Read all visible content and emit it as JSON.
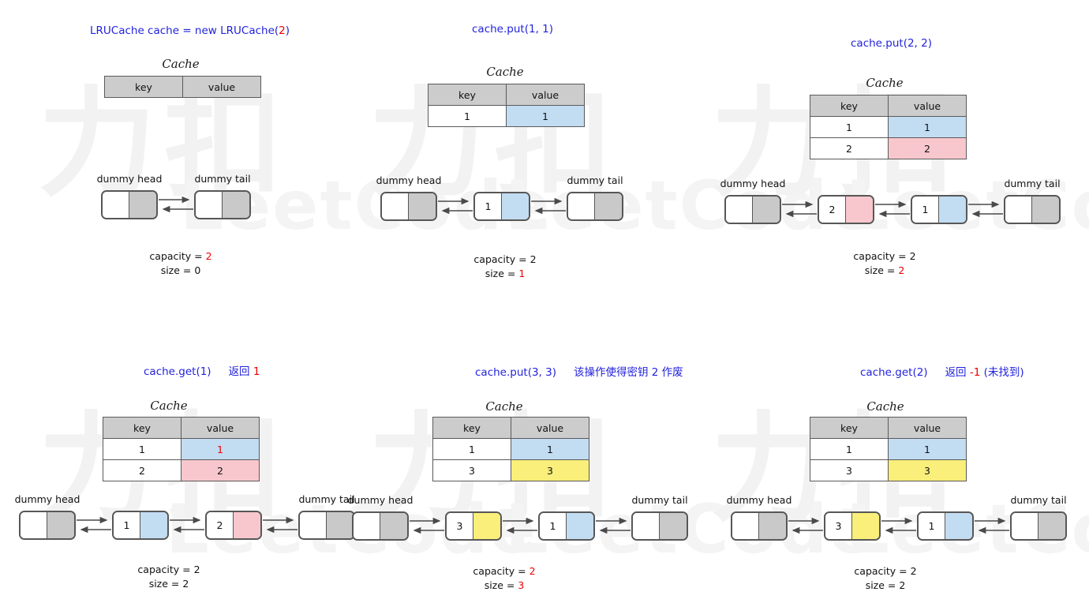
{
  "colors": {
    "op_text": "#2222dd",
    "highlight_red": "#ee0000",
    "value_blue": "#c2dcf2",
    "value_pink": "#f8c7cd",
    "value_yellow": "#f9ef7a",
    "node_gray": "#c9c9c9",
    "header_gray": "#cccccc",
    "border": "#575757"
  },
  "watermark": {
    "cjk": "力扣",
    "word": "LeetCode"
  },
  "labels": {
    "cache_title": "Cache",
    "col_key": "key",
    "col_value": "value",
    "dummy_head": "dummy head",
    "dummy_tail": "dummy tail",
    "capacity_prefix": "capacity = ",
    "size_prefix": "size = "
  },
  "panels": [
    {
      "id": "panel-1-construct",
      "title": {
        "prefix": "LRUCache cache = new LRUCache(",
        "red": "2",
        "suffix": ")",
        "note": "",
        "note_red": "",
        "note_suffix": ""
      },
      "table": {
        "headers": [
          "key",
          "value"
        ],
        "rows": []
      },
      "list": {
        "nodes": [
          {
            "type": "dummy",
            "label": "dummy head",
            "key": "",
            "color": "gray"
          },
          {
            "type": "dummy",
            "label": "dummy tail",
            "key": "",
            "color": "gray"
          }
        ]
      },
      "stats": {
        "capacity": "2",
        "capacity_red": true,
        "size": "0",
        "size_red": false
      }
    },
    {
      "id": "panel-2-put-1-1",
      "title": {
        "prefix": "cache.put(1, 1)",
        "red": "",
        "suffix": "",
        "note": "",
        "note_red": "",
        "note_suffix": ""
      },
      "table": {
        "headers": [
          "key",
          "value"
        ],
        "rows": [
          {
            "key": "1",
            "value": "1",
            "value_color": "blue",
            "value_red": false
          }
        ]
      },
      "list": {
        "nodes": [
          {
            "type": "dummy",
            "label": "dummy head",
            "key": "",
            "color": "gray"
          },
          {
            "type": "data",
            "label": "",
            "key": "1",
            "color": "blue"
          },
          {
            "type": "dummy",
            "label": "dummy tail",
            "key": "",
            "color": "gray"
          }
        ]
      },
      "stats": {
        "capacity": "2",
        "capacity_red": false,
        "size": "1",
        "size_red": true
      }
    },
    {
      "id": "panel-3-put-2-2",
      "title": {
        "prefix": "cache.put(2, 2)",
        "red": "",
        "suffix": "",
        "note": "",
        "note_red": "",
        "note_suffix": ""
      },
      "table": {
        "headers": [
          "key",
          "value"
        ],
        "rows": [
          {
            "key": "1",
            "value": "1",
            "value_color": "blue",
            "value_red": false
          },
          {
            "key": "2",
            "value": "2",
            "value_color": "pink",
            "value_red": false
          }
        ]
      },
      "list": {
        "nodes": [
          {
            "type": "dummy",
            "label": "dummy head",
            "key": "",
            "color": "gray"
          },
          {
            "type": "data",
            "label": "",
            "key": "2",
            "color": "pink"
          },
          {
            "type": "data",
            "label": "",
            "key": "1",
            "color": "blue"
          },
          {
            "type": "dummy",
            "label": "dummy tail",
            "key": "",
            "color": "gray"
          }
        ]
      },
      "stats": {
        "capacity": "2",
        "capacity_red": false,
        "size": "2",
        "size_red": true
      }
    },
    {
      "id": "panel-4-get-1",
      "title": {
        "prefix": "cache.get(1)",
        "red": "",
        "suffix": "",
        "note": "返回 ",
        "note_red": "1",
        "note_suffix": ""
      },
      "table": {
        "headers": [
          "key",
          "value"
        ],
        "rows": [
          {
            "key": "1",
            "value": "1",
            "value_color": "blue",
            "value_red": true
          },
          {
            "key": "2",
            "value": "2",
            "value_color": "pink",
            "value_red": false
          }
        ]
      },
      "list": {
        "nodes": [
          {
            "type": "dummy",
            "label": "dummy head",
            "key": "",
            "color": "gray"
          },
          {
            "type": "data",
            "label": "",
            "key": "1",
            "color": "blue"
          },
          {
            "type": "data",
            "label": "",
            "key": "2",
            "color": "pink"
          },
          {
            "type": "dummy",
            "label": "dummy tail",
            "key": "",
            "color": "gray"
          }
        ]
      },
      "stats": {
        "capacity": "2",
        "capacity_red": false,
        "size": "2",
        "size_red": false
      }
    },
    {
      "id": "panel-5-put-3-3",
      "title": {
        "prefix": "cache.put(3, 3)",
        "red": "",
        "suffix": "",
        "note": "该操作使得密钥 2 作废",
        "note_red": "",
        "note_suffix": ""
      },
      "table": {
        "headers": [
          "key",
          "value"
        ],
        "rows": [
          {
            "key": "1",
            "value": "1",
            "value_color": "blue",
            "value_red": false
          },
          {
            "key": "3",
            "value": "3",
            "value_color": "yellow",
            "value_red": false
          }
        ]
      },
      "list": {
        "nodes": [
          {
            "type": "dummy",
            "label": "dummy head",
            "key": "",
            "color": "gray"
          },
          {
            "type": "data",
            "label": "",
            "key": "3",
            "color": "yellow"
          },
          {
            "type": "data",
            "label": "",
            "key": "1",
            "color": "blue"
          },
          {
            "type": "dummy",
            "label": "dummy tail",
            "key": "",
            "color": "gray"
          }
        ]
      },
      "stats": {
        "capacity": "2",
        "capacity_red": true,
        "size": "3",
        "size_red": true
      }
    },
    {
      "id": "panel-6-get-2",
      "title": {
        "prefix": "cache.get(2)",
        "red": "",
        "suffix": "",
        "note": "返回 ",
        "note_red": "-1",
        "note_suffix": " (未找到)"
      },
      "table": {
        "headers": [
          "key",
          "value"
        ],
        "rows": [
          {
            "key": "1",
            "value": "1",
            "value_color": "blue",
            "value_red": false
          },
          {
            "key": "3",
            "value": "3",
            "value_color": "yellow",
            "value_red": false
          }
        ]
      },
      "list": {
        "nodes": [
          {
            "type": "dummy",
            "label": "dummy head",
            "key": "",
            "color": "gray"
          },
          {
            "type": "data",
            "label": "",
            "key": "3",
            "color": "yellow"
          },
          {
            "type": "data",
            "label": "",
            "key": "1",
            "color": "blue"
          },
          {
            "type": "dummy",
            "label": "dummy tail",
            "key": "",
            "color": "gray"
          }
        ]
      },
      "stats": {
        "capacity": "2",
        "capacity_red": false,
        "size": "2",
        "size_red": false
      }
    }
  ]
}
